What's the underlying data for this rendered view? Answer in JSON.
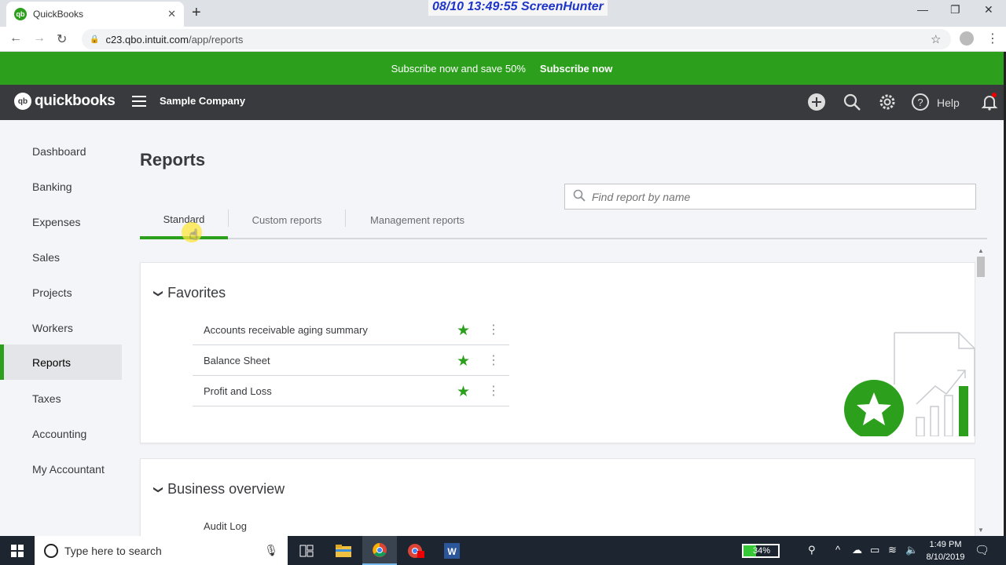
{
  "browser": {
    "tab_title": "QuickBooks",
    "favicon_text": "qb",
    "close_glyph": "✕",
    "newtab_glyph": "+",
    "stamp": "08/10  13:49:55  ScreenHunter",
    "url_host": "c23.qbo.intuit.com",
    "url_path": "/app/reports"
  },
  "banner": {
    "text": "Subscribe now and save 50%",
    "link": "Subscribe now"
  },
  "header": {
    "logo_text": "quickbooks",
    "logo_badge": "qb",
    "company": "Sample Company",
    "help_label": "Help"
  },
  "sidebar": {
    "items": [
      {
        "label": "Dashboard"
      },
      {
        "label": "Banking"
      },
      {
        "label": "Expenses"
      },
      {
        "label": "Sales"
      },
      {
        "label": "Projects"
      },
      {
        "label": "Workers"
      },
      {
        "label": "Reports"
      },
      {
        "label": "Taxes"
      },
      {
        "label": "Accounting"
      },
      {
        "label": "My Accountant"
      }
    ],
    "active": "Reports"
  },
  "main": {
    "title": "Reports",
    "search_placeholder": "Find report by name",
    "tabs": [
      {
        "label": "Standard"
      },
      {
        "label": "Custom reports"
      },
      {
        "label": "Management reports"
      }
    ],
    "active_tab": "Standard",
    "favorites": {
      "heading": "Favorites",
      "reports": [
        {
          "label": "Accounts receivable aging summary"
        },
        {
          "label": "Balance Sheet"
        },
        {
          "label": "Profit and Loss"
        }
      ]
    },
    "business_overview": {
      "heading": "Business overview",
      "reports": [
        {
          "label": "Audit Log"
        }
      ]
    }
  },
  "taskbar": {
    "search_placeholder": "Type here to search",
    "battery": "34%",
    "time": "1:49 PM",
    "date": "8/10/2019"
  },
  "colors": {
    "brand_green": "#2ca01c",
    "header_dark": "#393a3d"
  }
}
